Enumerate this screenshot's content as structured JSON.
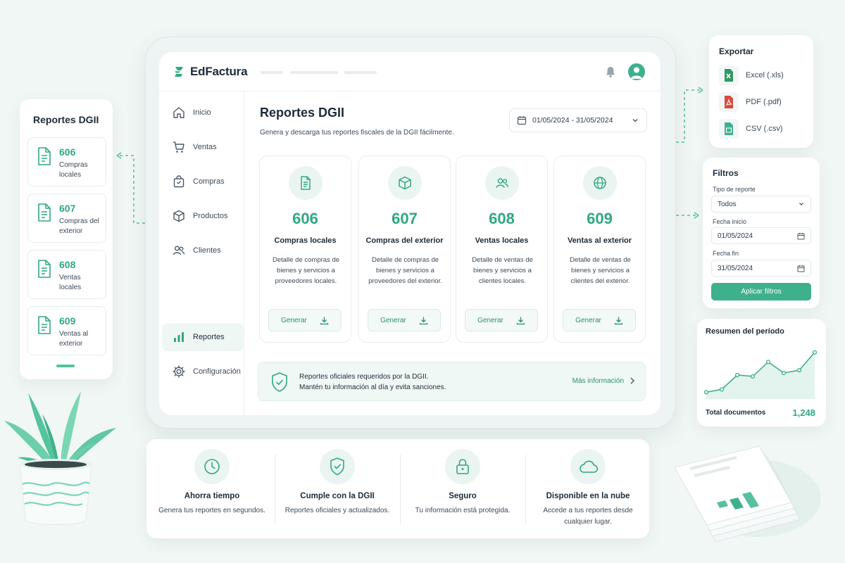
{
  "app": {
    "name": "EdFactura"
  },
  "sidebar": {
    "items": [
      {
        "label": "Inicio",
        "icon": "home-icon"
      },
      {
        "label": "Ventas",
        "icon": "cart-icon"
      },
      {
        "label": "Compras",
        "icon": "bag-icon"
      },
      {
        "label": "Productos",
        "icon": "box-icon"
      },
      {
        "label": "Clientes",
        "icon": "users-icon"
      },
      {
        "label": "Reportes",
        "icon": "bar-chart-icon",
        "active": true
      },
      {
        "label": "Configuración",
        "icon": "gear-icon"
      }
    ]
  },
  "main": {
    "title": "Reportes DGII",
    "subtitle": "Genera y descarga tus reportes fiscales de la DGII fácilmente.",
    "date_range": "01/05/2024 - 31/05/2024",
    "reports": [
      {
        "code": "606",
        "title": "Compras locales",
        "desc": "Detalle de compras de bienes y servicios a proveedores locales.",
        "button": "Generar",
        "icon": "document-icon"
      },
      {
        "code": "607",
        "title": "Compras del exterior",
        "desc": "Detalle de compras de bienes y servicios a proveedores del exterior.",
        "button": "Generar",
        "icon": "package-icon"
      },
      {
        "code": "608",
        "title": "Ventas locales",
        "desc": "Detalle de ventas de bienes y servicios a clientes locales.",
        "button": "Generar",
        "icon": "users-icon"
      },
      {
        "code": "609",
        "title": "Ventas al exterior",
        "desc": "Detalle de ventas de bienes y servicios a clientes del exterior.",
        "button": "Generar",
        "icon": "globe-icon"
      }
    ],
    "info": {
      "line1": "Reportes oficiales requeridos por la DGII.",
      "line2": "Mantén tu información al día y evita sanciones.",
      "link": "Más información"
    }
  },
  "left_panel": {
    "title": "Reportes DGII",
    "items": [
      {
        "code": "606",
        "name": "Compras locales"
      },
      {
        "code": "607",
        "name": "Compras del exterior"
      },
      {
        "code": "608",
        "name": "Ventas locales"
      },
      {
        "code": "609",
        "name": "Ventas al exterior"
      }
    ]
  },
  "export": {
    "title": "Exportar",
    "items": [
      {
        "label": "Excel (.xls)",
        "icon": "excel-icon",
        "color": "#2e9a62"
      },
      {
        "label": "PDF (.pdf)",
        "icon": "pdf-icon",
        "color": "#d94a3c"
      },
      {
        "label": "CSV (.csv)",
        "icon": "csv-icon",
        "color": "#3fb08d"
      }
    ]
  },
  "filters": {
    "title": "Filtros",
    "type_label": "Tipo de reporte",
    "type_value": "Todos",
    "start_label": "Fecha inicio",
    "start_value": "01/05/2024",
    "end_label": "Fecha fin",
    "end_value": "31/05/2024",
    "apply": "Aplicar filtros"
  },
  "summary": {
    "title": "Resumen del período",
    "total_label": "Total documentos",
    "total_value": "1,248"
  },
  "chart_data": {
    "type": "area",
    "title": "Resumen del período",
    "xlabel": "",
    "ylabel": "",
    "x": [
      1,
      2,
      3,
      4,
      5,
      6,
      7,
      8
    ],
    "values": [
      10,
      14,
      35,
      33,
      54,
      38,
      42,
      68
    ],
    "ylim": [
      0,
      80
    ],
    "grid": false,
    "legend": "none"
  },
  "features": [
    {
      "title": "Ahorra tiempo",
      "desc": "Genera tus reportes en segundos.",
      "icon": "clock-icon"
    },
    {
      "title": "Cumple con la DGII",
      "desc": "Reportes oficiales y actualizados.",
      "icon": "shield-check-icon"
    },
    {
      "title": "Seguro",
      "desc": "Tu información está protegida.",
      "icon": "lock-icon"
    },
    {
      "title": "Disponible en la nube",
      "desc": "Accede a tus reportes desde cualquier lugar.",
      "icon": "cloud-icon"
    }
  ],
  "colors": {
    "accent": "#3fb08d",
    "accent_text": "#2fa883",
    "background": "#f1f7f5",
    "text": "#1d2b3a"
  }
}
